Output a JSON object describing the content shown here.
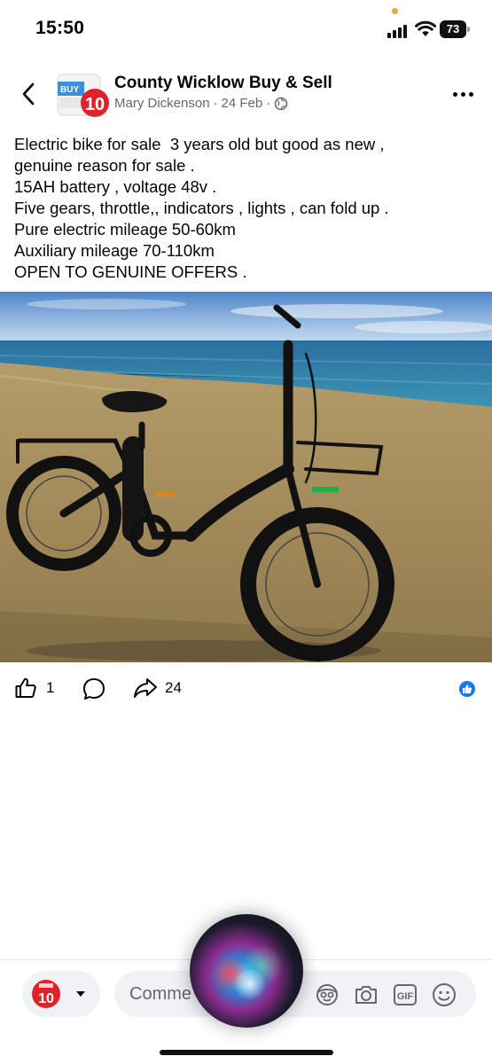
{
  "status_bar": {
    "time": "15:50",
    "battery": "73"
  },
  "header": {
    "group_name": "County Wicklow Buy & Sell",
    "author": "Mary Dickenson",
    "separator": "·",
    "date": "24 Feb",
    "separator2": "·",
    "back_icon": "chevron-left-icon",
    "privacy_icon": "globe-icon",
    "more_icon": "more-dots-icon",
    "avatar_badge_text": "BUY",
    "avatar_number": "10"
  },
  "post": {
    "lines": [
      "Electric bike for sale  3 years old but good as new ,",
      "genuine reason for sale .",
      "15AH battery , voltage 48v .",
      "Five gears, throttle,, indicators , lights , can fold up .",
      "Pure electric mileage 50-60km",
      "Auxiliary mileage 70-110km",
      "OPEN TO GENUINE OFFERS ."
    ],
    "photo_alt": "Black folding electric bike with fat tyres on a grassy clifftop by the sea"
  },
  "actions": {
    "like_count": "1",
    "share_count": "24",
    "like_icon": "thumbs-up-icon",
    "comment_icon": "comment-bubble-icon",
    "share_icon": "share-arrow-icon",
    "reaction_icon": "like-reaction-icon"
  },
  "composer": {
    "placeholder": "Comme",
    "avatar_number": "10",
    "icons": [
      "avatar-sticker-icon",
      "camera-icon",
      "gif-icon",
      "emoji-icon"
    ],
    "gif_label": "GIF"
  },
  "colors": {
    "accent": "#1877f2",
    "meta_text": "#65676b",
    "input_bg": "#f0f2f5"
  }
}
